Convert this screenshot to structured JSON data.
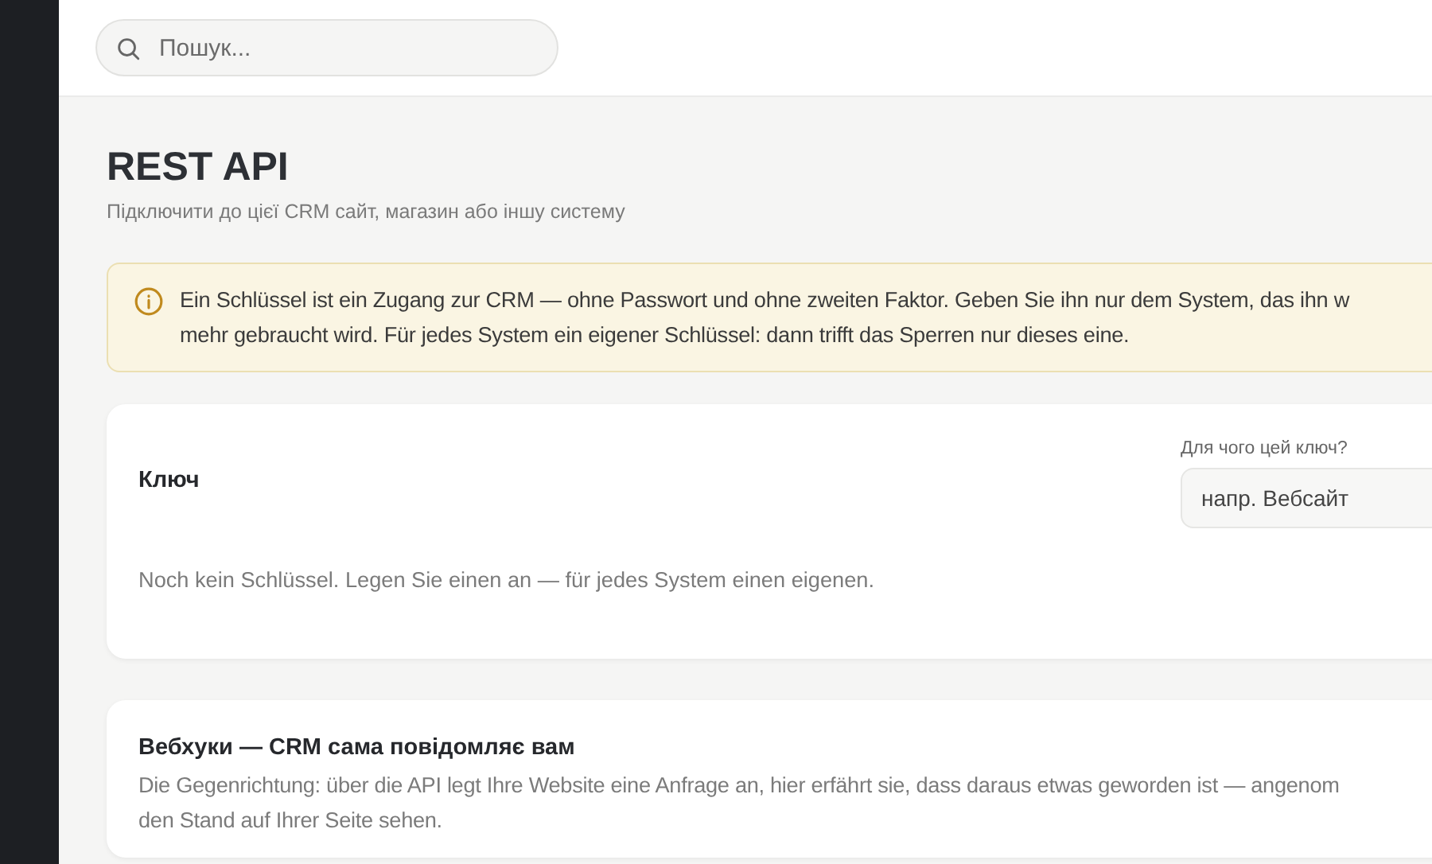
{
  "search": {
    "placeholder": "Пошук..."
  },
  "header": {
    "title": "REST API",
    "subtitle": "Підключити до цієї CRM сайт, магазин або іншу систему"
  },
  "notice": {
    "lines": [
      "Ein Schlüssel ist ein Zugang zur CRM — ohne Passwort und ohne zweiten Faktor. Geben Sie ihn nur dem System, das ihn w",
      "mehr gebraucht wird. Für jedes System ein eigener Schlüssel: dann trifft das Sperren nur dieses eine."
    ]
  },
  "key_card": {
    "title": "Ключ",
    "field_label": "Для чого цей ключ?",
    "field_placeholder": "напр. Вебсайт",
    "empty_text": "Noch kein Schlüssel. Legen Sie einen an — für jedes System einen eigenen."
  },
  "webhooks_card": {
    "title": "Вебхуки — CRM сама повідомляє вам",
    "lines": [
      "Die Gegenrichtung: über die API legt Ihre Website eine Anfrage an, hier erfährt sie, dass daraus etwas geworden ist — angenom",
      "den Stand auf Ihrer Seite sehen."
    ]
  }
}
